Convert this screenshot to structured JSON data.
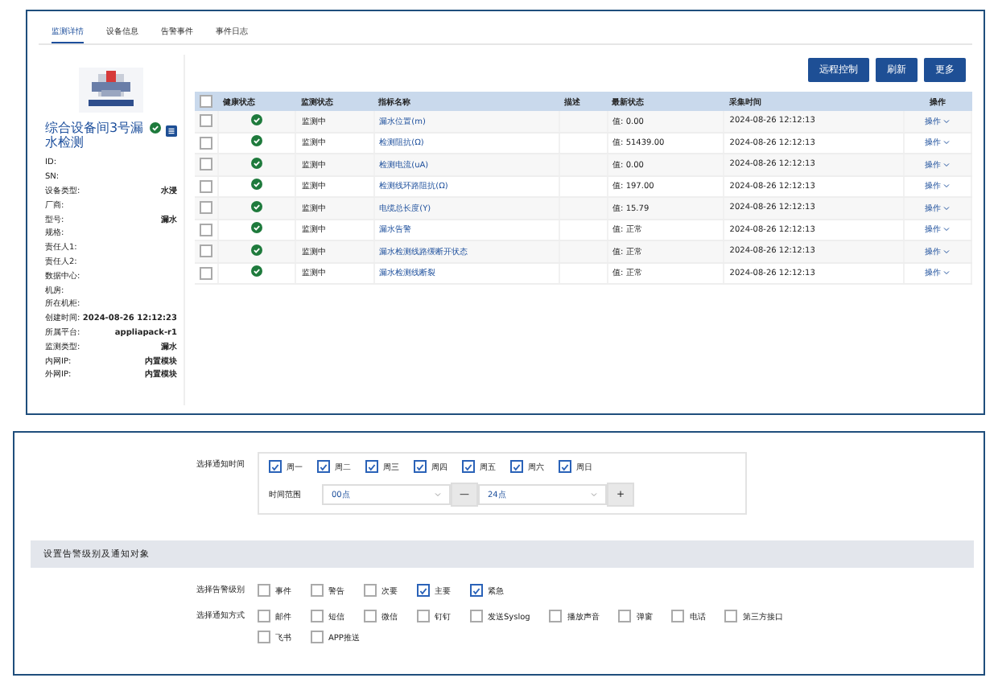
{
  "tabs": [
    {
      "label": "监测详情",
      "selected": true
    },
    {
      "label": "设备信息",
      "selected": false
    },
    {
      "label": "告警事件",
      "selected": false
    },
    {
      "label": "事件日志",
      "selected": false
    }
  ],
  "device": {
    "name": "综合设备间3号漏水检测",
    "healthy": true,
    "fields": [
      {
        "label": "ID:"
      },
      {
        "label": "SN:"
      },
      {
        "label": "设备类型:",
        "value": "水浸"
      },
      {
        "label": "厂商:"
      },
      {
        "label": "型号:",
        "value": "漏水"
      },
      {
        "label": "规格:"
      },
      {
        "label": "责任人1:"
      },
      {
        "label": "责任人2:"
      },
      {
        "label": "数据中心:"
      },
      {
        "label": "机房:"
      },
      {
        "label": "所在机柜:"
      },
      {
        "label": "创建时间:",
        "value": "2024-08-26 12:12:23"
      },
      {
        "label": "所属平台:",
        "value": "appliapack-r1"
      },
      {
        "label": "监测类型:",
        "value": "漏水"
      },
      {
        "label": "内网IP:",
        "value": "内置模块"
      },
      {
        "label": "外网IP:",
        "value": "内置模块"
      }
    ]
  },
  "toolbar": [
    "远程控制",
    "刷新",
    "更多"
  ],
  "table": {
    "select_all": {
      "checked": false
    },
    "columns": [
      "健康状态",
      "监测状态",
      "指标名称",
      "描述",
      "最新状态",
      "采集时间",
      "操作"
    ],
    "rows": [
      {
        "checked": false,
        "healthy": true,
        "status": "监测中",
        "name": "漏水位置(m)",
        "value": "值: 0.00",
        "time": "2024-08-26 12:12:13",
        "action": "操作"
      },
      {
        "checked": false,
        "healthy": true,
        "status": "监测中",
        "name": "检测阻抗(Ω)",
        "value": "值: 51439.00",
        "time": "2024-08-26 12:12:13",
        "action": "操作"
      },
      {
        "checked": false,
        "healthy": true,
        "status": "监测中",
        "name": "检测电流(uA)",
        "value": "值: 0.00",
        "time": "2024-08-26 12:12:13",
        "action": "操作"
      },
      {
        "checked": false,
        "healthy": true,
        "status": "监测中",
        "name": "检测线环路阻抗(Ω)",
        "value": "值: 197.00",
        "time": "2024-08-26 12:12:13",
        "action": "操作"
      },
      {
        "checked": false,
        "healthy": true,
        "status": "监测中",
        "name": "电缆总长度(Y)",
        "value": "值: 15.79",
        "time": "2024-08-26 12:12:13",
        "action": "操作"
      },
      {
        "checked": false,
        "healthy": true,
        "status": "监测中",
        "name": "漏水告警",
        "value": "值: 正常",
        "time": "2024-08-26 12:12:13",
        "action": "操作"
      },
      {
        "checked": false,
        "healthy": true,
        "status": "监测中",
        "name": "漏水检测线路缓断开状态",
        "value": "值: 正常",
        "time": "2024-08-26 12:12:13",
        "action": "操作"
      },
      {
        "checked": false,
        "healthy": true,
        "status": "监测中",
        "name": "漏水检测线断裂",
        "value": "值: 正常",
        "time": "2024-08-26 12:12:13",
        "action": "操作"
      }
    ]
  },
  "notify_time": {
    "label": "选择通知时间",
    "days": [
      {
        "label": "周一",
        "checked": true
      },
      {
        "label": "周二",
        "checked": true
      },
      {
        "label": "周三",
        "checked": true
      },
      {
        "label": "周四",
        "checked": true
      },
      {
        "label": "周五",
        "checked": true
      },
      {
        "label": "周六",
        "checked": true
      },
      {
        "label": "周日",
        "checked": true
      }
    ],
    "range_label": "时间范围",
    "start": "00点",
    "separator": "—",
    "end": "24点",
    "add": "+"
  },
  "section_title": "设置告警级别及通知对象",
  "levels": {
    "label": "选择告警级别",
    "options": [
      {
        "label": "事件",
        "checked": false
      },
      {
        "label": "警告",
        "checked": false
      },
      {
        "label": "次要",
        "checked": false
      },
      {
        "label": "主要",
        "checked": true
      },
      {
        "label": "紧急",
        "checked": true
      }
    ]
  },
  "methods": {
    "label": "选择通知方式",
    "options": [
      {
        "label": "邮件",
        "checked": false
      },
      {
        "label": "短信",
        "checked": false
      },
      {
        "label": "微信",
        "checked": false
      },
      {
        "label": "钉钉",
        "checked": false
      },
      {
        "label": "发送Syslog",
        "checked": false
      },
      {
        "label": "播放声音",
        "checked": false
      },
      {
        "label": "弹窗",
        "checked": false
      },
      {
        "label": "电话",
        "checked": false
      },
      {
        "label": "第三方接口",
        "checked": false
      },
      {
        "label": "飞书",
        "checked": false
      },
      {
        "label": "APP推送",
        "checked": false
      }
    ]
  }
}
